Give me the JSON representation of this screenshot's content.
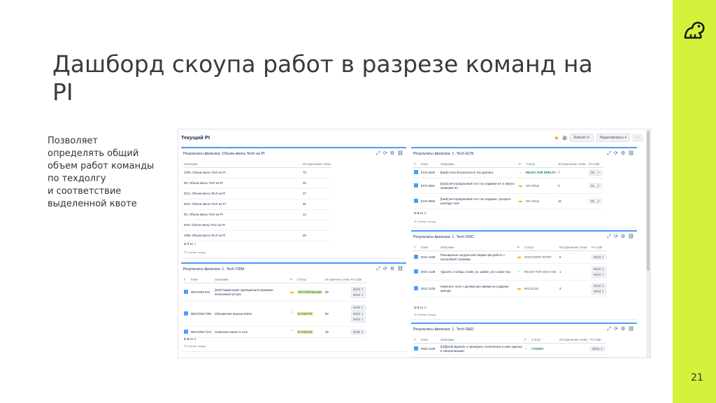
{
  "slide": {
    "title": "Дашборд скоупа работ в разрезе команд на PI",
    "description": "Позволяет\nопределять общий\nобъем работ команды\nпо техдолгу\nи соответствие\nвыделенной квоте",
    "page_number": "21",
    "accent_color": "#d2f23c",
    "logo_icon": "frog-icon"
  },
  "dashboard": {
    "title": "Текущий PI",
    "refresh_label": "Refresh ⟳",
    "share_label": "Редактировать ▾",
    "more_label": "···",
    "gadgets": {
      "quota": {
        "title": "Результаты фильтра: Объем квоты Tech на PI",
        "headers": [
          "Описание",
          "Исторические точки"
        ],
        "rows": [
          {
            "desc": "CRM. Объем квоты Tech на PI",
            "points": "79"
          },
          {
            "desc": "D2. Объем квоты Tech на PI",
            "points": "26"
          },
          {
            "desc": "DCS. Объем квоты Tech на PI",
            "points": "37"
          },
          {
            "desc": "DOC. Объем квоты Tech на PI",
            "points": "40"
          },
          {
            "desc": "R2. Объем квоты Tech на PI",
            "points": "14"
          },
          {
            "desc": "RnD. Объем квоты Tech на PI",
            "points": ""
          },
          {
            "desc": "CRB. Объем квоты Tech на PI",
            "points": "40"
          }
        ],
        "footer_count": "1–7",
        "footer_of": "из 7",
        "updated": "⟲ 2 минут назад"
      },
      "crm": {
        "title": "Результаты фильтра: 1. Tech CRM",
        "headers": [
          "T",
          "Ключ",
          "Описание",
          "P",
          "Статус",
          "Историческ точки",
          "PI Code"
        ],
        "rows": [
          {
            "key": "DBVCRM-924",
            "desc": "[SM] Рефакторинг функционала проверки неоказаный услуги",
            "status": "ТЕСТИРОВАНИЕ",
            "points": "89",
            "pi": [
              "05/24 ⇕",
              "06/24 ⇕"
            ]
          },
          {
            "key": "DBVCRM-7391",
            "desc": "Обновление версии dotnet",
            "status": "В РАБОТЕ",
            "points": "58",
            "pi": [
              "04/24 ⇕",
              "05/24 ⇕",
              "06/24 ⇕"
            ]
          },
          {
            "key": "DBVCRM-7147",
            "desc": "Ostanewe клиент в core",
            "status": "В РАБОТЕ",
            "points": "39",
            "pi": [
              "06/24 ⇕"
            ]
          }
        ],
        "footer_count": "1–3",
        "footer_of": "из 3",
        "updated": "⟲ 5 минут назад"
      },
      "ecn": {
        "title": "Результаты фильтра: 1. Tech ECN",
        "headers": [
          "T",
          "Ключ",
          "Описание",
          "P",
          "Статус",
          "Исторические точки",
          "PI Code"
        ],
        "rows": [
          {
            "key": "ECN-2620",
            "desc": "[back] Лога безопасности тип доклата",
            "status": "READY FOR DEPLOY",
            "status_class": "st-green",
            "points": "7",
            "pi": "06... ⇕"
          },
          {
            "key": "ECN-2651",
            "desc": "[back] интеграционный тест на создание КА и Запуск проверки КА",
            "status": "ON HOLD",
            "status_class": "st-grey",
            "points": "0",
            "pi": "06... ⇕"
          },
          {
            "key": "ECN-2650",
            "desc": "[back] интеграционный тест на создание, ускорить доклада 'now'",
            "status": "ON HOLD",
            "status_class": "st-grey",
            "points": "16",
            "pi": "06... ⇕"
          }
        ],
        "footer_count": "1–3",
        "footer_of": "из 3",
        "updated": "⟲ 5 минут назад"
      },
      "doc": {
        "title": "Результаты фильтра: 1. Tech DOC",
        "headers": [
          "T",
          "Ключ",
          "Описание",
          "P",
          "Статус",
          "Исторические точки",
          "PI Code"
        ],
        "rows": [
          {
            "key": "DOC-1169",
            "desc": "Расширение нагрузочной сварки при работе с настройкой страницы",
            "status": "DISCOVERY-START",
            "points": "6",
            "pi": [
              "05/24 ⇕"
            ]
          },
          {
            "key": "DOC-1138",
            "desc": "Удалить столбцы create_at, update_at в схеме ssq",
            "status": "READY FOR ANALYSIS",
            "points": "1",
            "pi": [
              "05/24 ⇕",
              "06/24 ⇕"
            ]
          },
          {
            "key": "DOC-1125",
            "desc": "Изменить поле с датами для заявки на создание аренды",
            "status": "BACKLOG",
            "points": "2",
            "pi": [
              "05/24 ⇕",
              "06/24 ⇕"
            ]
          }
        ],
        "footer_count": "1–3",
        "footer_of": "из 3",
        "updated": "⟲ 5 минут назад"
      },
      "rnd": {
        "title": "Результаты фильтра: 1. Tech R&D",
        "headers": [
          "T",
          "Ключ",
          "Описание",
          "P",
          "Статус",
          "Исторические точки",
          "PI Code"
        ],
        "rows": [
          {
            "key": "RND-1048",
            "desc": "[UI][back] Бранинг и проверить технических в шаге данных в синхронизации",
            "status": "СТОЛКО",
            "points": "",
            "pi": "06/24 ⇕"
          }
        ]
      }
    }
  }
}
